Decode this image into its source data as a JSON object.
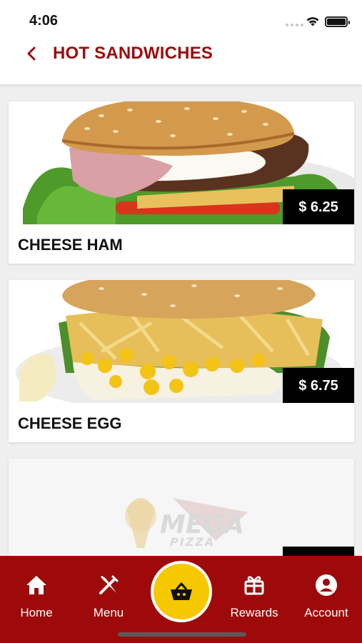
{
  "status": {
    "time": "4:06"
  },
  "header": {
    "title": "HOT SANDWICHES",
    "back_icon": "chevron-left-icon"
  },
  "items": [
    {
      "name": "CHEESE HAM",
      "price": "$ 6.25"
    },
    {
      "name": "CHEESE EGG",
      "price": "$ 6.75"
    },
    {
      "name": "",
      "price": "",
      "placeholder_logo": "MEGA PIZZA"
    }
  ],
  "nav": {
    "home": "Home",
    "menu": "Menu",
    "rewards": "Rewards",
    "account": "Account"
  },
  "colors": {
    "brand": "#9e0a0a",
    "accent": "#f5c800"
  }
}
